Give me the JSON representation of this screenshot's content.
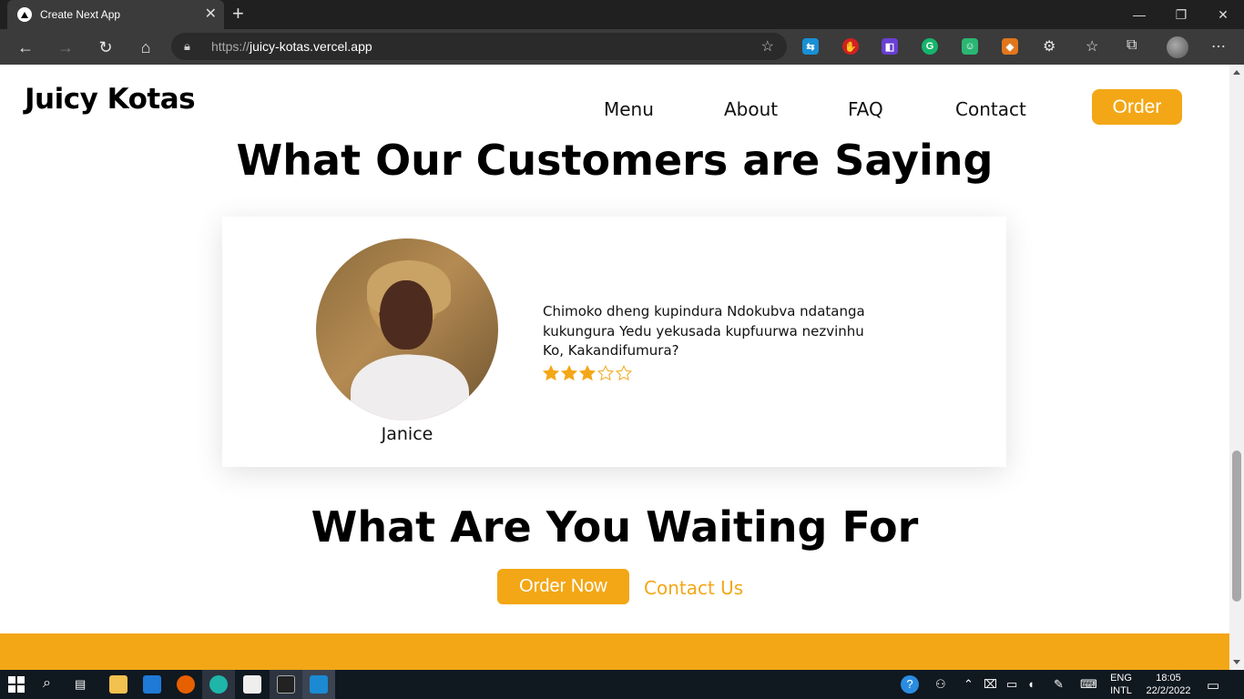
{
  "browser": {
    "tab_title": "Create Next App",
    "url_protocol": "https://",
    "url_host": "juicy-kotas.vercel.app"
  },
  "site": {
    "logo": "Juicy Kotas",
    "nav": [
      "Menu",
      "About",
      "FAQ",
      "Contact"
    ],
    "order_button": "Order"
  },
  "testimonials": {
    "heading": "What Our Customers are Saying",
    "items": [
      {
        "name": "Janice",
        "quote": "Chimoko dheng kupindura Ndokubva ndatanga kukungura Yedu yekusada kupfuurwa nezvinhu Ko, Kakandifumura?",
        "rating": 3,
        "max_rating": 5
      }
    ]
  },
  "cta": {
    "heading": "What Are You Waiting For",
    "primary_button": "Order Now",
    "secondary_link": "Contact Us"
  },
  "taskbar": {
    "lang_top": "ENG",
    "lang_bottom": "INTL",
    "time": "18:05",
    "date": "22/2/2022"
  },
  "colors": {
    "accent": "#f3a716",
    "chrome_dark": "#202020",
    "taskbar": "#101820"
  }
}
